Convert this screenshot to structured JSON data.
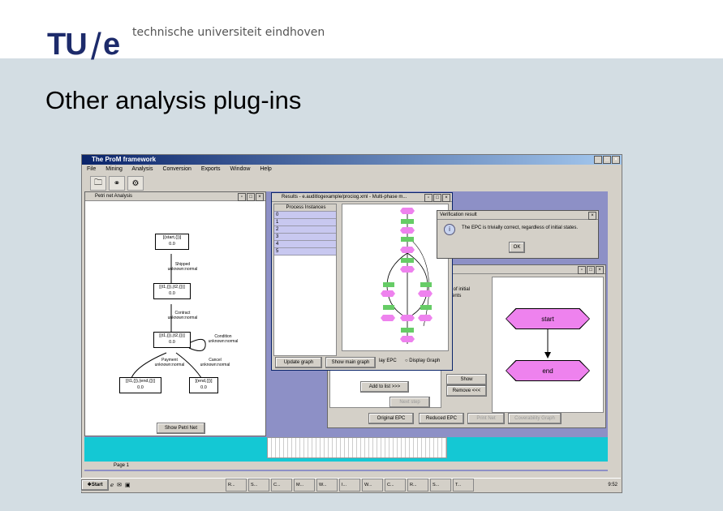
{
  "slide": {
    "logo_tu": "TU",
    "logo_slash": "/",
    "logo_e": "e",
    "logo_text": "technische universiteit eindhoven",
    "title": "Other analysis plug-ins"
  },
  "app": {
    "title": "The ProM framework",
    "menu": [
      "File",
      "Mining",
      "Analysis",
      "Conversion",
      "Exports",
      "Window",
      "Help"
    ],
    "petri_frame": {
      "title": "Petri net Analysis",
      "nodes": [
        "[(start,{})]",
        "0.0",
        "[(t1,{}),(t2,{})]",
        "0.0",
        "[(t1,{}),(t2,{})]",
        "0.0",
        "[(t1,{}),(end,{})]",
        "0.0",
        "[(end,{})]",
        "0.0"
      ],
      "labels": [
        "Shipped",
        "unknown:normal",
        "Contract",
        "unknown:normal",
        "Condition",
        "unknown:normal",
        "Payment",
        "unknown:normal",
        "Cancel",
        "unknown:normal"
      ],
      "show_button": "Show Petri Net"
    },
    "results_frame": {
      "title": "Results - e.auditlogexample/prociog.xml - Multi-phase m...",
      "list_header": "Process Instances",
      "instances": [
        "0",
        "1",
        "2",
        "3",
        "4",
        "5"
      ],
      "update_button": "Update graph",
      "show_main_button": "Show main graph",
      "radio1": "lay EPC",
      "radio2": "Display Graph"
    },
    "verification": {
      "title": "Verification result",
      "message": "The EPC is trivially correct, regardless of initial states.",
      "ok": "OK"
    },
    "epc_frame": {
      "side_text_1": "s of initial",
      "side_text_2": "vents",
      "start_label": "start",
      "end_label": "end",
      "show_button": "Show",
      "add_button": "Add to list >>>",
      "remove_button": "Remove <<<",
      "next_button": "Next step",
      "tabs": [
        "Original EPC",
        "Reduced EPC",
        "Print Net",
        "Coverability Graph"
      ]
    },
    "statusbar": {
      "page": "Page 1"
    }
  },
  "taskbar": {
    "start": "Start",
    "clock": "9:52",
    "tasks": [
      "R...",
      "S...",
      "C...",
      "M...",
      "W...",
      "I...",
      "W...",
      "C...",
      "R...",
      "S...",
      "T..."
    ]
  },
  "colors": {
    "logo": "#1d2b6b",
    "band": "#d3dde3",
    "desktop": "#8d90c6",
    "teal": "#14c8d4",
    "epc_magenta": "#ee82ee",
    "function_green": "#66cc66"
  }
}
